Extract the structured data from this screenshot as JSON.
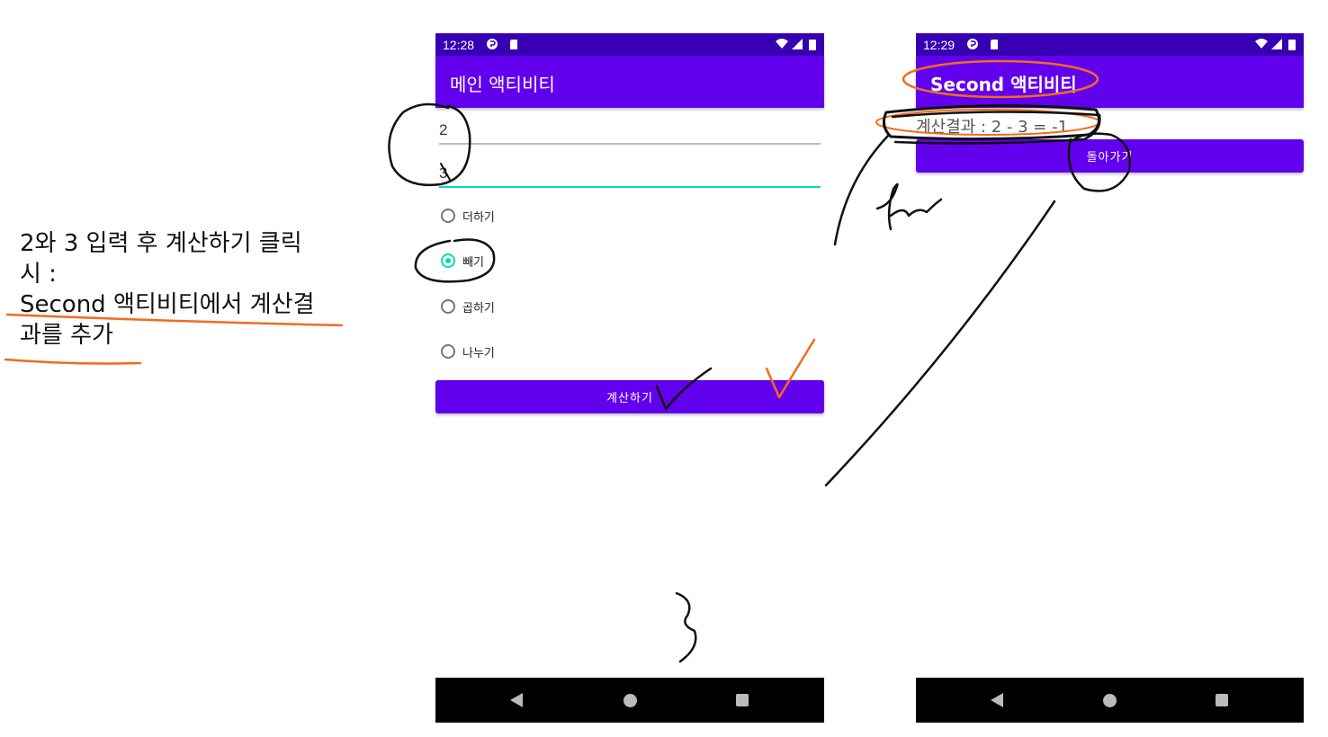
{
  "caption": {
    "line1": "2와 3 입력 후 계산하기 클릭",
    "line2": "시 :",
    "line3": "Second 액티비티에서 계산결",
    "line4": "과를 추가"
  },
  "main_screen": {
    "status_time": "12:28",
    "title": "메인 액티비티",
    "input1_value": "2",
    "input2_value": "3",
    "radio_options": [
      {
        "label": "더하기",
        "checked": false
      },
      {
        "label": "빼기",
        "checked": true
      },
      {
        "label": "곱하기",
        "checked": false
      },
      {
        "label": "나누기",
        "checked": false
      }
    ],
    "calc_button_label": "계산하기"
  },
  "second_screen": {
    "status_time": "12:29",
    "title": "Second 액티비티",
    "result_text": "계산결과 : 2 - 3 = -1",
    "back_button_label": "돌아가기"
  },
  "colors": {
    "status_bar": "#3700b3",
    "app_bar": "#6200ee",
    "accent": "#03dac5",
    "ink_black": "#111111",
    "ink_orange": "#f26b1d"
  },
  "icons": {
    "status_left": [
      "settings-app-icon",
      "sd-card-icon"
    ],
    "status_right": [
      "wifi-icon",
      "signal-icon",
      "battery-icon"
    ],
    "nav": [
      "back-icon",
      "home-icon",
      "recents-icon"
    ]
  }
}
